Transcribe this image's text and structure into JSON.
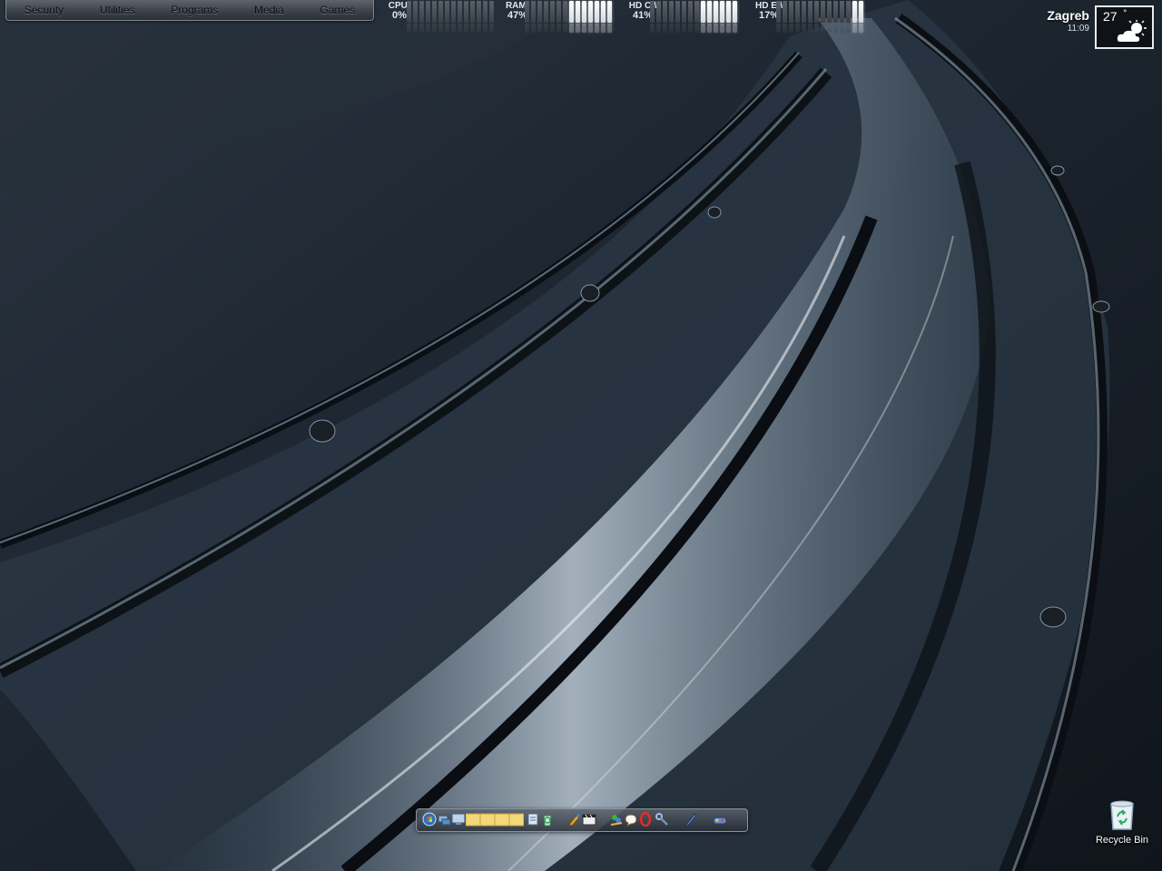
{
  "menubar": {
    "items": [
      "Security",
      "Utilities",
      "Programs",
      "Media",
      "Games"
    ]
  },
  "meters": [
    {
      "label": "CPU:",
      "value": "0%",
      "fraction": 0.0
    },
    {
      "label": "RAM:",
      "value": "47%",
      "fraction": 0.47
    },
    {
      "label": "HD C:\\",
      "value": "41%",
      "fraction": 0.41
    },
    {
      "label": "HD E:\\",
      "value": "17%",
      "fraction": 0.17
    }
  ],
  "weather": {
    "city": "Zagreb",
    "time": "11:09",
    "temperature": "27",
    "degree_symbol": "°",
    "icon": "partly-cloudy-icon"
  },
  "dock": {
    "icons": [
      "start-orb-icon",
      "network-icon",
      "computer-icon",
      "folder-icon",
      "folder-icon",
      "folder-icon",
      "folder-icon",
      "notepad-icon",
      "recycle-icon",
      "paint-icon",
      "media-center-icon",
      "messenger-icon",
      "chat-icon",
      "opera-icon",
      "tools-icon",
      "pen-icon",
      "games-icon"
    ]
  },
  "desktop": {
    "recycle_bin_label": "Recycle Bin"
  },
  "colors": {
    "background": "#1a222c",
    "accent_light": "#c9d6e2"
  }
}
